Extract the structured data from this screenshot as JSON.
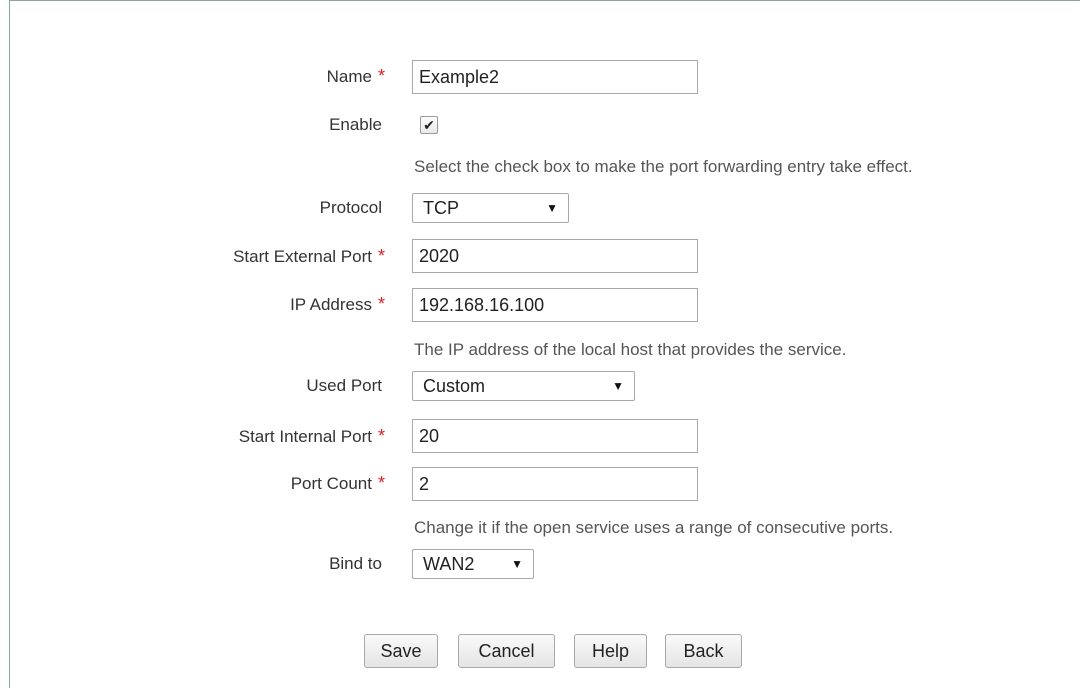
{
  "form": {
    "name": {
      "label": "Name",
      "value": "Example2"
    },
    "enable": {
      "label": "Enable",
      "checked": true,
      "check_glyph": "✔",
      "hint": "Select the check box to make the port forwarding entry take effect."
    },
    "protocol": {
      "label": "Protocol",
      "value": "TCP"
    },
    "start_external_port": {
      "label": "Start External Port",
      "value": "2020"
    },
    "ip_address": {
      "label": "IP Address",
      "value": "192.168.16.100",
      "hint": "The IP address of the local host that provides the service."
    },
    "used_port": {
      "label": "Used Port",
      "value": "Custom"
    },
    "start_internal_port": {
      "label": "Start Internal Port",
      "value": "20"
    },
    "port_count": {
      "label": "Port Count",
      "value": "2",
      "hint": "Change it if the open service uses a range of consecutive ports."
    },
    "bind_to": {
      "label": "Bind to",
      "value": "WAN2"
    },
    "required_mark": "*",
    "dropdown_glyph": "▼"
  },
  "buttons": {
    "save": "Save",
    "cancel": "Cancel",
    "help": "Help",
    "back": "Back"
  },
  "colors": {
    "required": "#e02020",
    "frame_border": "#8aa4a0"
  }
}
